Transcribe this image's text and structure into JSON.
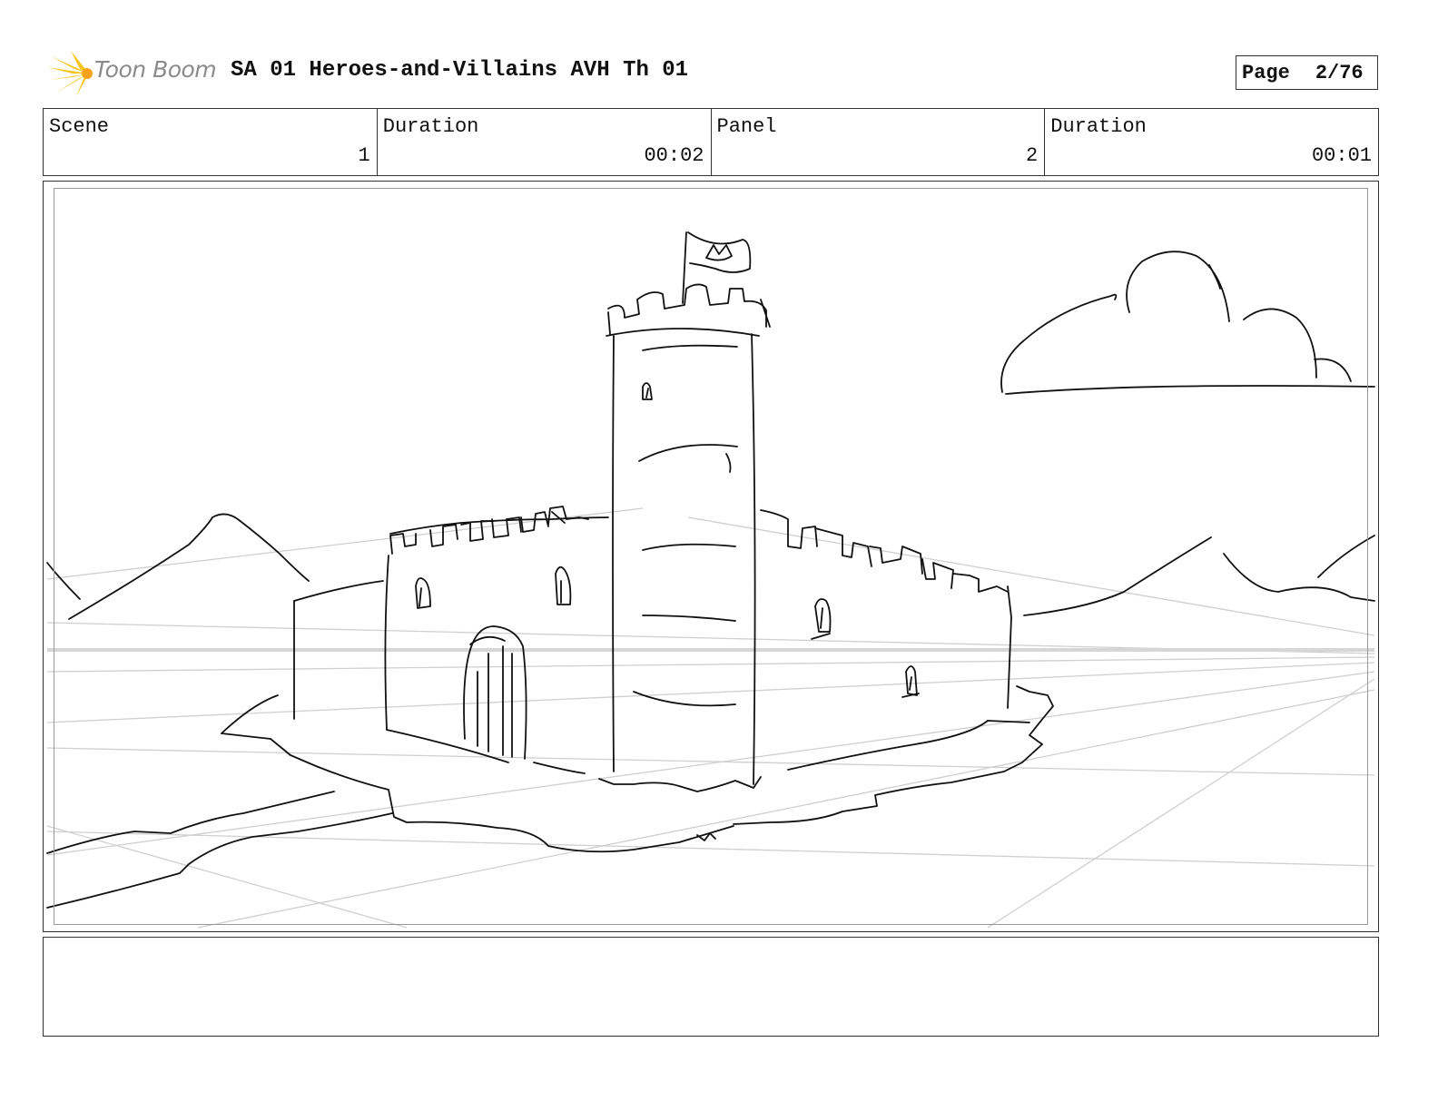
{
  "header": {
    "logo_text": "Toon Boom",
    "title": "SA 01 Heroes-and-Villains AVH Th 01",
    "page_label": "Page",
    "page_value": "2/76"
  },
  "info": {
    "scene_label": "Scene",
    "scene_value": "1",
    "scene_duration_label": "Duration",
    "scene_duration_value": "00:02",
    "panel_label": "Panel",
    "panel_value": "2",
    "panel_duration_label": "Duration",
    "panel_duration_value": "00:01"
  },
  "panel": {
    "image_icon": "castle-sketch",
    "colors": {
      "line": "#111111",
      "guide": "#c8c8c8",
      "horizon": "#d6d6d6"
    }
  },
  "notes": {
    "action_text": ""
  }
}
